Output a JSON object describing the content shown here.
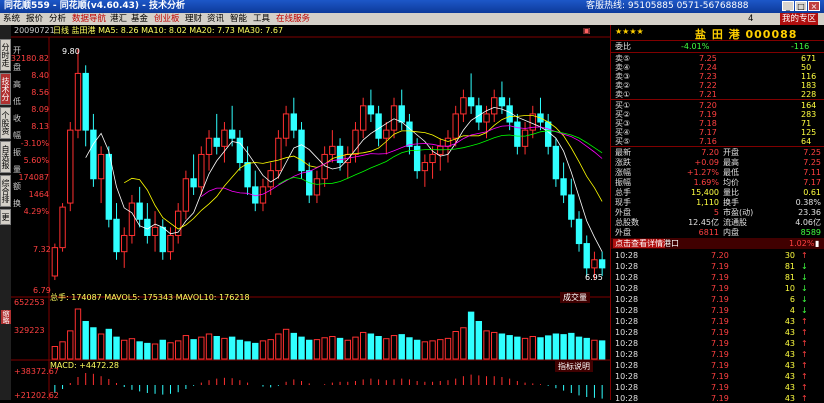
{
  "window": {
    "title": "同花顺559 - 同花顺(v4.60.43) - 技术分析",
    "hotline": "客服热线: 95105885  0571-56768888",
    "btn_min": "_",
    "btn_max": "□",
    "btn_close": "×"
  },
  "menu": {
    "items": [
      "系统",
      "报价",
      "分析",
      "数据导航",
      "港汇",
      "基金",
      "创业板",
      "理财",
      "资讯",
      "智能",
      "工具",
      "在线服务"
    ],
    "right": "4",
    "home": "我的专区"
  },
  "left_tabs": [
    "分时走势",
    "技术分析",
    "个股资料",
    "自选报价",
    "综合排名",
    "更多"
  ],
  "chart": {
    "date": "20090721",
    "header": "日线  盐田港  MA5: 8.26  MA10: 8.02  MA20: 7.73  MA30: 7.67",
    "hi_label": "9.80",
    "lo_label": "6.95",
    "price_ticks": [
      "7.32",
      "6.79"
    ],
    "vol_ticks": [
      "652253",
      "329223"
    ],
    "vol_header": "总手: 174087  MAVOL5: 175343  MAVOL10: 176218",
    "vol_btn": "成交量",
    "macd_header": "MACD: +4472.28",
    "macd_btn": "指标说明",
    "macd_ticks": [
      "+38372.67",
      "+21202.62"
    ],
    "info_panel": [
      {
        "k": "开",
        "v": "32180.82"
      },
      {
        "k": "盘",
        "v": "8.40"
      },
      {
        "k": "高",
        "v": "8.56"
      },
      {
        "k": "低",
        "v": "8.09"
      },
      {
        "k": "收",
        "v": "8.13"
      },
      {
        "k": "幅",
        "v": "-3.10%"
      },
      {
        "k": "振",
        "v": "5.60%"
      },
      {
        "k": "量",
        "v": "174087"
      },
      {
        "k": "额",
        "v": "1464"
      },
      {
        "k": "换",
        "v": "4.29%"
      }
    ],
    "ohlc": [
      [
        7.0,
        7.4,
        6.95,
        7.35
      ],
      [
        7.35,
        7.9,
        7.3,
        7.85
      ],
      [
        7.9,
        8.9,
        7.8,
        8.8
      ],
      [
        8.8,
        9.8,
        8.7,
        9.5
      ],
      [
        9.5,
        9.6,
        8.6,
        8.8
      ],
      [
        8.8,
        9.0,
        8.1,
        8.2
      ],
      [
        8.2,
        8.6,
        7.9,
        8.5
      ],
      [
        8.5,
        8.6,
        7.6,
        7.7
      ],
      [
        7.7,
        7.9,
        7.2,
        7.3
      ],
      [
        7.3,
        7.6,
        7.1,
        7.5
      ],
      [
        7.5,
        8.0,
        7.4,
        7.9
      ],
      [
        7.9,
        8.1,
        7.6,
        7.7
      ],
      [
        7.7,
        7.9,
        7.4,
        7.5
      ],
      [
        7.5,
        7.8,
        7.3,
        7.6
      ],
      [
        7.6,
        7.7,
        7.2,
        7.3
      ],
      [
        7.3,
        7.6,
        7.2,
        7.5
      ],
      [
        7.5,
        7.9,
        7.4,
        7.8
      ],
      [
        7.8,
        8.3,
        7.7,
        8.2
      ],
      [
        8.2,
        8.5,
        8.0,
        8.1
      ],
      [
        8.1,
        8.6,
        8.0,
        8.5
      ],
      [
        8.5,
        8.8,
        8.3,
        8.7
      ],
      [
        8.7,
        9.0,
        8.5,
        8.6
      ],
      [
        8.6,
        8.9,
        8.4,
        8.8
      ],
      [
        8.8,
        9.1,
        8.6,
        8.7
      ],
      [
        8.7,
        8.8,
        8.3,
        8.4
      ],
      [
        8.4,
        8.6,
        8.0,
        8.1
      ],
      [
        8.1,
        8.3,
        7.8,
        7.9
      ],
      [
        7.9,
        8.2,
        7.8,
        8.1
      ],
      [
        8.1,
        8.4,
        8.0,
        8.3
      ],
      [
        8.3,
        8.8,
        8.2,
        8.7
      ],
      [
        8.7,
        9.1,
        8.6,
        9.0
      ],
      [
        9.0,
        9.2,
        8.7,
        8.8
      ],
      [
        8.8,
        8.9,
        8.2,
        8.3
      ],
      [
        8.3,
        8.4,
        7.9,
        8.0
      ],
      [
        8.0,
        8.3,
        7.9,
        8.2
      ],
      [
        8.2,
        8.6,
        8.1,
        8.5
      ],
      [
        8.5,
        8.8,
        8.4,
        8.6
      ],
      [
        8.6,
        8.7,
        8.3,
        8.4
      ],
      [
        8.4,
        8.6,
        8.2,
        8.5
      ],
      [
        8.5,
        8.9,
        8.4,
        8.8
      ],
      [
        8.8,
        9.2,
        8.7,
        9.1
      ],
      [
        9.1,
        9.3,
        8.9,
        9.0
      ],
      [
        9.0,
        9.1,
        8.6,
        8.7
      ],
      [
        8.7,
        8.9,
        8.5,
        8.8
      ],
      [
        8.8,
        9.2,
        8.7,
        9.1
      ],
      [
        9.1,
        9.3,
        8.8,
        8.9
      ],
      [
        8.9,
        9.0,
        8.5,
        8.6
      ],
      [
        8.6,
        8.7,
        8.2,
        8.3
      ],
      [
        8.3,
        8.5,
        8.1,
        8.4
      ],
      [
        8.4,
        8.6,
        8.2,
        8.5
      ],
      [
        8.5,
        8.7,
        8.3,
        8.6
      ],
      [
        8.6,
        8.8,
        8.4,
        8.7
      ],
      [
        8.7,
        9.1,
        8.6,
        9.0
      ],
      [
        9.0,
        9.3,
        8.9,
        9.2
      ],
      [
        9.2,
        9.5,
        9.0,
        9.1
      ],
      [
        9.1,
        9.2,
        8.8,
        8.9
      ],
      [
        8.9,
        9.1,
        8.7,
        9.0
      ],
      [
        9.0,
        9.3,
        8.9,
        9.2
      ],
      [
        9.2,
        9.4,
        9.0,
        9.1
      ],
      [
        9.1,
        9.2,
        8.8,
        8.9
      ],
      [
        8.9,
        9.0,
        8.5,
        8.6
      ],
      [
        8.6,
        8.9,
        8.5,
        8.8
      ],
      [
        8.8,
        9.1,
        8.7,
        9.0
      ],
      [
        9.0,
        9.2,
        8.8,
        8.9
      ],
      [
        8.9,
        9.0,
        8.5,
        8.6
      ],
      [
        8.6,
        8.7,
        8.1,
        8.2
      ],
      [
        8.2,
        8.4,
        7.9,
        8.0
      ],
      [
        8.0,
        8.2,
        7.6,
        7.7
      ],
      [
        7.7,
        7.8,
        7.3,
        7.4
      ],
      [
        7.4,
        7.5,
        7.0,
        7.1
      ],
      [
        7.1,
        7.3,
        6.95,
        7.2
      ],
      [
        7.2,
        7.3,
        7.0,
        7.1
      ]
    ],
    "volumes": [
      40,
      55,
      90,
      160,
      120,
      100,
      80,
      95,
      70,
      60,
      65,
      55,
      50,
      48,
      60,
      52,
      58,
      75,
      62,
      70,
      80,
      72,
      66,
      70,
      60,
      55,
      50,
      58,
      62,
      80,
      95,
      82,
      70,
      60,
      62,
      68,
      72,
      66,
      60,
      70,
      85,
      80,
      72,
      65,
      75,
      78,
      68,
      60,
      55,
      58,
      62,
      66,
      88,
      100,
      150,
      120,
      90,
      85,
      80,
      75,
      70,
      66,
      72,
      68,
      74,
      80,
      78,
      82,
      70,
      66,
      60,
      58
    ],
    "macd": [
      -20,
      -10,
      5,
      20,
      30,
      28,
      22,
      15,
      5,
      -5,
      -12,
      -16,
      -20,
      -22,
      -24,
      -22,
      -18,
      -10,
      -2,
      6,
      12,
      16,
      18,
      17,
      12,
      6,
      0,
      -4,
      -6,
      -2,
      8,
      14,
      10,
      4,
      0,
      2,
      6,
      8,
      8,
      10,
      14,
      16,
      14,
      12,
      14,
      16,
      14,
      10,
      8,
      8,
      10,
      12,
      16,
      22,
      26,
      24,
      22,
      22,
      20,
      16,
      10,
      6,
      4,
      2,
      -2,
      -8,
      -14,
      -20,
      -26,
      -30,
      -32,
      -34
    ]
  },
  "quote": {
    "stars": "★★★★",
    "name": "盐 田 港 000088",
    "weibi": {
      "label": "委比",
      "value": "-4.01%",
      "diff": "-116"
    },
    "sells": [
      {
        "label": "卖⑤",
        "price": "7.25",
        "vol": "671"
      },
      {
        "label": "卖④",
        "price": "7.24",
        "vol": "50"
      },
      {
        "label": "卖③",
        "price": "7.23",
        "vol": "116"
      },
      {
        "label": "卖②",
        "price": "7.22",
        "vol": "183"
      },
      {
        "label": "卖①",
        "price": "7.21",
        "vol": "228"
      }
    ],
    "buys": [
      {
        "label": "买①",
        "price": "7.20",
        "vol": "164"
      },
      {
        "label": "买②",
        "price": "7.19",
        "vol": "283"
      },
      {
        "label": "买③",
        "price": "7.18",
        "vol": "71"
      },
      {
        "label": "买④",
        "price": "7.17",
        "vol": "125"
      },
      {
        "label": "买⑤",
        "price": "7.16",
        "vol": "64"
      }
    ],
    "stats": [
      {
        "k1": "最新",
        "v1": "7.20",
        "k2": "开盘",
        "v2": "7.25",
        "c1": "up",
        "c2": "up"
      },
      {
        "k1": "涨跌",
        "v1": "+0.09",
        "k2": "最高",
        "v2": "7.25",
        "c1": "up",
        "c2": "up"
      },
      {
        "k1": "涨幅",
        "v1": "+1.27%",
        "k2": "最低",
        "v2": "7.11",
        "c1": "up",
        "c2": "up"
      },
      {
        "k1": "振幅",
        "v1": "1.69%",
        "k2": "均价",
        "v2": "7.17",
        "c1": "up",
        "c2": "up"
      },
      {
        "k1": "总手",
        "v1": "15,400",
        "k2": "量比",
        "v2": "0.61",
        "c1": "yl",
        "c2": "yl"
      },
      {
        "k1": "现手",
        "v1": "1,110",
        "k2": "换手",
        "v2": "0.38%",
        "c1": "yl",
        "c2": "wh"
      },
      {
        "k1": "外盘",
        "v1": "5",
        "k2": "市盈(动)",
        "v2": "23.36",
        "c1": "up",
        "c2": "wh"
      },
      {
        "k1": "总股数",
        "v1": "12.45亿",
        "k2": "流通股",
        "v2": "4.06亿",
        "c1": "wh",
        "c2": "wh"
      },
      {
        "k1": "外盘",
        "v1": "6811",
        "k2": "内盘",
        "v2": "8589",
        "c1": "up",
        "c2": "dn"
      }
    ],
    "trade_btn": "点击查看详情",
    "trade_tab": "港口",
    "trade_pct": "1.02%",
    "trades": [
      {
        "t": "10:28",
        "p": "7.20",
        "v": "30",
        "d": "up"
      },
      {
        "t": "10:28",
        "p": "7.19",
        "v": "81",
        "d": "dn"
      },
      {
        "t": "10:28",
        "p": "7.19",
        "v": "81",
        "d": "dn"
      },
      {
        "t": "10:28",
        "p": "7.19",
        "v": "10",
        "d": "dn"
      },
      {
        "t": "10:28",
        "p": "7.19",
        "v": "6",
        "d": "dn"
      },
      {
        "t": "10:28",
        "p": "7.19",
        "v": "4",
        "d": "dn"
      },
      {
        "t": "10:28",
        "p": "7.19",
        "v": "43",
        "d": "up"
      },
      {
        "t": "10:28",
        "p": "7.19",
        "v": "43",
        "d": "up"
      },
      {
        "t": "10:28",
        "p": "7.19",
        "v": "43",
        "d": "up"
      },
      {
        "t": "10:28",
        "p": "7.19",
        "v": "43",
        "d": "up"
      },
      {
        "t": "10:28",
        "p": "7.19",
        "v": "43",
        "d": "up"
      },
      {
        "t": "10:28",
        "p": "7.19",
        "v": "43",
        "d": "up"
      },
      {
        "t": "10:28",
        "p": "7.19",
        "v": "43",
        "d": "up"
      },
      {
        "t": "10:28",
        "p": "7.19",
        "v": "43",
        "d": "up"
      }
    ]
  },
  "colors": {
    "up": "#ff3030",
    "down": "#30ffff",
    "ma5": "#ffffff",
    "ma10": "#ffff00",
    "ma20": "#ff00ff",
    "ma30": "#00ff00"
  }
}
